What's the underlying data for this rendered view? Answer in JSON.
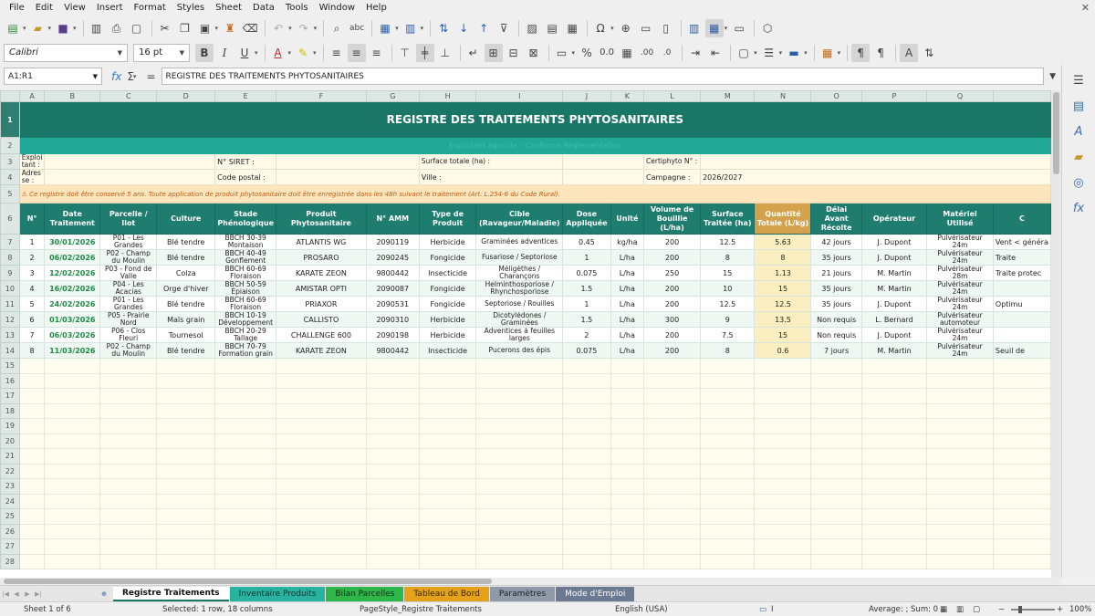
{
  "menu": [
    "File",
    "Edit",
    "View",
    "Insert",
    "Format",
    "Styles",
    "Sheet",
    "Data",
    "Tools",
    "Window",
    "Help"
  ],
  "toolbar": {
    "font_name": "Calibri",
    "font_size": "16 pt"
  },
  "formula_bar": {
    "cell_ref": "A1:R1",
    "content": "REGISTRE DES TRAITEMENTS PHYTOSANITAIRES"
  },
  "columns": [
    "A",
    "B",
    "C",
    "D",
    "E",
    "F",
    "G",
    "H",
    "I",
    "J",
    "K",
    "L",
    "M",
    "N",
    "O",
    "P",
    "Q",
    ""
  ],
  "sheet": {
    "title": "REGISTRE DES TRAITEMENTS PHYTOSANITAIRES",
    "subtitle": "Exploitant agricole – Conforme Réglementation",
    "info": {
      "r3_a": "Exploi tant :",
      "r3_siret_label": "N° SIRET :",
      "r3_surface_label": "Surface totale (ha) :",
      "r3_certiphyto_label": "Certiphyto N° :",
      "r4_a": "Adres se :",
      "r4_cp_label": "Code postal :",
      "r4_ville_label": "Ville :",
      "r4_campagne_label": "Campagne :",
      "r4_campagne_value": "2026/2027"
    },
    "warning": "⚠ Ce registre doit être conservé 5 ans. Toute application de produit phytosanitaire doit être enregistrée dans les 48h suivant le traitement (Art. L.254-6 du Code Rural).",
    "headers": [
      "N°",
      "Date Traitement",
      "Parcelle / Ilot",
      "Culture",
      "Stade Phénologique",
      "Produit Phytosanitaire",
      "N° AMM",
      "Type de Produit",
      "Cible (Ravageur/Maladie)",
      "Dose Appliquée",
      "Unité",
      "Volume de Bouillie (L/ha)",
      "Surface Traitée (ha)",
      "Quantité Totale (L/kg)",
      "Délai Avant Récolte",
      "Opérateur",
      "Matériel Utilisé",
      "C"
    ],
    "rows": [
      [
        "1",
        "30/01/2026",
        "P01 - Les Grandes",
        "Blé tendre",
        "BBCH 30-39 Montaison",
        "ATLANTIS WG",
        "2090119",
        "Herbicide",
        "Graminées adventices",
        "0.45",
        "kg/ha",
        "200",
        "12.5",
        "5.63",
        "42 jours",
        "J. Dupont",
        "Pulvérisateur 24m",
        "Vent < généra"
      ],
      [
        "2",
        "06/02/2026",
        "P02 - Champ du Moulin",
        "Blé tendre",
        "BBCH 40-49 Gonflement",
        "PROSARO",
        "2090245",
        "Fongicide",
        "Fusariose / Septoriose",
        "1",
        "L/ha",
        "200",
        "8",
        "8",
        "35 jours",
        "J. Dupont",
        "Pulvérisateur 24m",
        "Traite"
      ],
      [
        "3",
        "12/02/2026",
        "P03 - Fond de Valle",
        "Colza",
        "BBCH 60-69 Floraison",
        "KARATE ZEON",
        "9800442",
        "Insecticide",
        "Méligèthes / Charançons",
        "0.075",
        "L/ha",
        "250",
        "15",
        "1.13",
        "21 jours",
        "M. Martin",
        "Pulvérisateur 28m",
        "Traite protec"
      ],
      [
        "4",
        "16/02/2026",
        "P04 - Les Acacias",
        "Orge d'hiver",
        "BBCH 50-59 Épiaison",
        "AMISTAR OPTI",
        "2090087",
        "Fongicide",
        "Helminthosporiose / Rhynchosporiose",
        "1.5",
        "L/ha",
        "200",
        "10",
        "15",
        "35 jours",
        "M. Martin",
        "Pulvérisateur 24m",
        ""
      ],
      [
        "5",
        "24/02/2026",
        "P01 - Les Grandes",
        "Blé tendre",
        "BBCH 60-69 Floraison",
        "PRIAXOR",
        "2090531",
        "Fongicide",
        "Septoriose / Rouilles",
        "1",
        "L/ha",
        "200",
        "12.5",
        "12.5",
        "35 jours",
        "J. Dupont",
        "Pulvérisateur 24m",
        "Optimu"
      ],
      [
        "6",
        "01/03/2026",
        "P05 - Prairie Nord",
        "Maïs grain",
        "BBCH 10-19 Développement",
        "CALLISTO",
        "2090310",
        "Herbicide",
        "Dicotylédones / Graminées",
        "1.5",
        "L/ha",
        "300",
        "9",
        "13.5",
        "Non requis",
        "L. Bernard",
        "Pulvérisateur automoteur",
        ""
      ],
      [
        "7",
        "06/03/2026",
        "P06 - Clos Fleuri",
        "Tournesol",
        "BBCH 20-29 Tallage",
        "CHALLENGE 600",
        "2090198",
        "Herbicide",
        "Adventices à feuilles larges",
        "2",
        "L/ha",
        "200",
        "7.5",
        "15",
        "Non requis",
        "J. Dupont",
        "Pulvérisateur 24m",
        ""
      ],
      [
        "8",
        "11/03/2026",
        "P02 - Champ du Moulin",
        "Blé tendre",
        "BBCH 70-79 Formation grain",
        "KARATE ZEON",
        "9800442",
        "Insecticide",
        "Pucerons des épis",
        "0.075",
        "L/ha",
        "200",
        "8",
        "0.6",
        "7 jours",
        "M. Martin",
        "Pulvérisateur 24m",
        "Seuil de"
      ]
    ],
    "row_numbers": [
      "1",
      "2",
      "3",
      "4",
      "5",
      "6",
      "7",
      "8",
      "9",
      "10",
      "11",
      "12",
      "13",
      "14",
      "15",
      "16",
      "17",
      "18",
      "19",
      "20",
      "21",
      "22",
      "23",
      "24",
      "25",
      "26",
      "27",
      "28"
    ]
  },
  "tabs": [
    {
      "label": "Registre Traitements",
      "color": "#ffffff",
      "text": "#111111",
      "active": true
    },
    {
      "label": "Inventaire Produits",
      "color": "#27b3a0",
      "text": "#10302b"
    },
    {
      "label": "Bilan Parcelles",
      "color": "#2fb64a",
      "text": "#0e2e14"
    },
    {
      "label": "Tableau de Bord",
      "color": "#e3a21a",
      "text": "#3a2600"
    },
    {
      "label": "Paramètres",
      "color": "#8f9aa8",
      "text": "#1a1f26"
    },
    {
      "label": "Mode d'Emploi",
      "color": "#6b7a90",
      "text": "#ffffff"
    }
  ],
  "status": {
    "sheet": "Sheet 1 of 6",
    "selection": "Selected: 1 row, 18 columns",
    "page_style": "PageStyle_Registre Traitements",
    "language": "English (USA)",
    "sum": "Average: ; Sum: 0",
    "zoom": "100%"
  }
}
